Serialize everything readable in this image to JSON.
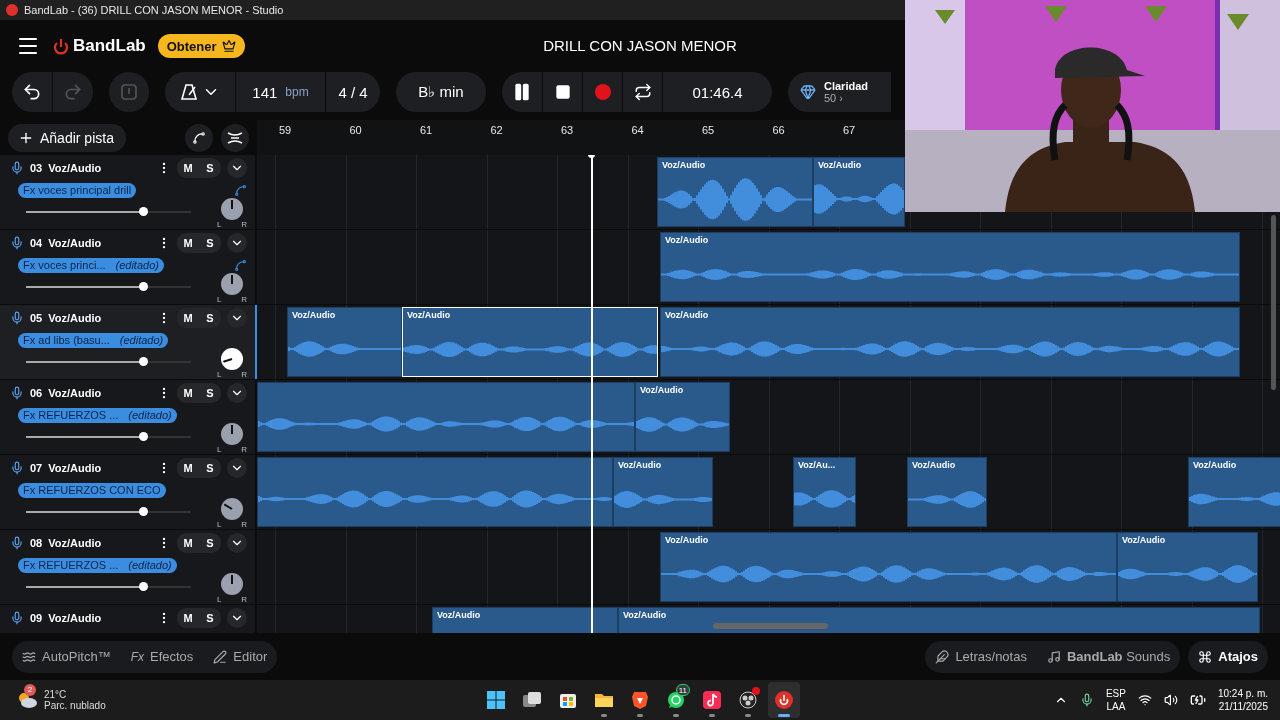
{
  "titlebar": {
    "title": "BandLab - (36) DRILL CON JASON MENOR - Studio"
  },
  "header": {
    "brand": "BandLab",
    "get_button": "Obtener",
    "project_title": "DRILL CON JASON MENOR"
  },
  "toolbar": {
    "undo": {
      "disabled": false
    },
    "redo": {
      "disabled": true
    },
    "tempo": "141",
    "tempo_unit": "bpm",
    "time_signature": "4 / 4",
    "key": "B♭ min",
    "time": "01:46.4",
    "clarity": {
      "label": "Claridad",
      "value": "50 ›"
    }
  },
  "add_track": "Añadir pista",
  "ruler": [
    "59",
    "60",
    "61",
    "62",
    "63",
    "64",
    "65",
    "66",
    "67"
  ],
  "tracks": [
    {
      "number": "03",
      "type": "Voz/Audio",
      "selected": false,
      "mute": "M",
      "solo": "S",
      "fx": "Fx voces principal drill",
      "automation": true,
      "volume": {
        "level": 0.71
      },
      "pan": {
        "level": 0.5,
        "left": "L",
        "right": "R"
      },
      "clips": [
        {
          "label": "Voz/Audio",
          "selected": false
        },
        {
          "label": "Voz/Audio",
          "selected": false
        }
      ]
    },
    {
      "number": "04",
      "type": "Voz/Audio",
      "selected": false,
      "mute": "M",
      "solo": "S",
      "fx": "Fx voces princi...",
      "edited": "(editado)",
      "automation": true,
      "volume": {
        "level": 0.71
      },
      "pan": {
        "level": 0.5,
        "left": "L",
        "right": "R"
      },
      "clips": [
        {
          "label": "Voz/Audio",
          "selected": false
        }
      ]
    },
    {
      "number": "05",
      "type": "Voz/Audio",
      "selected": true,
      "mute": "M",
      "solo": "S",
      "fx": "Fx ad libs (basu...",
      "edited": "(editado)",
      "automation": false,
      "volume": {
        "level": 0.71
      },
      "pan": {
        "level": 0.1,
        "left": "L",
        "right": "R"
      },
      "clips": [
        {
          "label": "Voz/Audio",
          "selected": false
        },
        {
          "label": "Voz/Audio",
          "selected": true
        },
        {
          "label": "Voz/Audio",
          "selected": false
        }
      ]
    },
    {
      "number": "06",
      "type": "Voz/Audio",
      "selected": false,
      "mute": "M",
      "solo": "S",
      "fx": "Fx REFUERZOS ...",
      "edited": "(editado)",
      "automation": false,
      "volume": {
        "level": 0.71
      },
      "pan": {
        "level": 0.5,
        "left": "L",
        "right": "R"
      },
      "clips": [
        {
          "selected": false
        },
        {
          "label": "Voz/Audio",
          "selected": false
        }
      ]
    },
    {
      "number": "07",
      "type": "Voz/Audio",
      "selected": false,
      "mute": "M",
      "solo": "S",
      "fx": "Fx REFUERZOS CON ECO",
      "automation": false,
      "volume": {
        "level": 0.71
      },
      "pan": {
        "level": 0.28,
        "left": "L",
        "right": "R"
      },
      "clips": [
        {
          "selected": false
        },
        {
          "label": "Voz/Audio",
          "selected": false
        },
        {
          "label": "Voz/Au...",
          "selected": false
        },
        {
          "label": "Voz/Audio",
          "selected": false
        },
        {
          "label": "Voz/Audio",
          "selected": false
        }
      ]
    },
    {
      "number": "08",
      "type": "Voz/Audio",
      "selected": false,
      "mute": "M",
      "solo": "S",
      "fx": "Fx REFUERZOS ...",
      "edited": "(editado)",
      "automation": false,
      "volume": {
        "level": 0.71
      },
      "pan": {
        "level": 0.5,
        "left": "L",
        "right": "R"
      },
      "clips": [
        {
          "label": "Voz/Audio",
          "selected": false
        },
        {
          "label": "Voz/Audio",
          "selected": false
        }
      ]
    },
    {
      "number": "09",
      "type": "Voz/Audio",
      "selected": false,
      "mute": "M",
      "solo": "S",
      "clips": [
        {
          "label": "Voz/Audio",
          "selected": false
        },
        {
          "label": "Voz/Audio",
          "selected": false
        }
      ]
    }
  ],
  "bottom_bar": {
    "left": [
      {
        "kind": "autopitch",
        "label": "AutoPitch™"
      },
      {
        "kind": "effects",
        "icon_text": "Fx",
        "label": "Efectos"
      },
      {
        "kind": "editor",
        "label": "Editor"
      }
    ],
    "right": [
      {
        "kind": "lyrics",
        "label": "Letras/notas"
      },
      {
        "kind": "sounds",
        "label": "**BandLab** Sounds"
      },
      {
        "kind": "shortcuts",
        "label": "Atajos"
      }
    ]
  },
  "taskbar": {
    "weather": {
      "temp": "21°C",
      "desc": "Parc. nublado",
      "badge": "2"
    },
    "apps": [
      {
        "kind": "start",
        "running": false,
        "active": false
      },
      {
        "kind": "taskview",
        "running": false,
        "active": false
      },
      {
        "kind": "store",
        "running": false,
        "active": false
      },
      {
        "kind": "explorer",
        "running": true,
        "active": false
      },
      {
        "kind": "brave",
        "running": true,
        "active": false
      },
      {
        "kind": "whatsapp",
        "running": true,
        "active": false,
        "badge": "11"
      },
      {
        "kind": "tiktok",
        "running": true,
        "active": false
      },
      {
        "kind": "obs",
        "running": true,
        "active": false,
        "alert": true
      },
      {
        "kind": "bandlab",
        "running": true,
        "active": true
      }
    ],
    "tray": {
      "lang": "ESP",
      "layout": "LAA",
      "time": "10:24 p. m.",
      "date": "21/11/2025"
    }
  }
}
